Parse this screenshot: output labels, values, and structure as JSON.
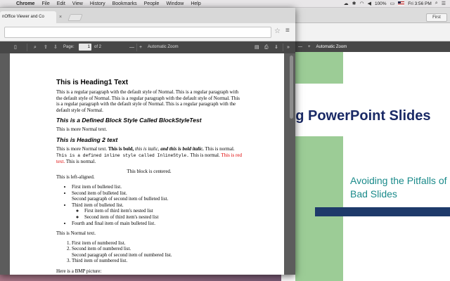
{
  "menubar": {
    "apple": "",
    "items": [
      "Chrome",
      "File",
      "Edit",
      "View",
      "History",
      "Bookmarks",
      "People",
      "Window",
      "Help"
    ],
    "battery": "100%",
    "clock": "Fri 3:56 PM"
  },
  "bg_window": {
    "first_button": "First",
    "zoom": "Automatic Zoom",
    "slide_title": "ng PowerPoint Slides",
    "slide_subtitle": "Avoiding the Pitfalls of Bad Slides"
  },
  "browser": {
    "tab_title": "nOffice Viewer and Co",
    "tab_close": "×",
    "menu_icon": "≡"
  },
  "pdf_toolbar": {
    "page_label": "Page:",
    "page_value": "1",
    "page_total": "of 2",
    "zoom_label": "Automatic Zoom"
  },
  "document": {
    "h1": "This is Heading1 Text",
    "para1": "This is a regular paragraph with the default style of Normal. This is a regular paragraph with the default style of Normal. This is a regular paragraph with the default style of Normal. This is a regular paragraph with the default style of Normal. This is a regular paragraph with the default style of Normal.",
    "block_style": "This is a Defined Block Style Called BlockStyleTest",
    "more_normal": "This is more Normal text.",
    "h2": "This is Heading 2 text",
    "mixed": {
      "t1": "This is more Normal text. ",
      "bold": "This is bold,",
      "t2": " ",
      "italic": "this is italic,",
      "t3": " ",
      "bold_italic": "and this is bold italic.",
      "t4": " This is normal. ",
      "mono": "This is a defined inline style called InlineStyle.",
      "t5": " This is normal. ",
      "red": "This is red text.",
      "t6": " This is normal."
    },
    "centered": "This block is centered.",
    "left_aligned": "This is left-aligned.",
    "bullets": {
      "b1": "First item of bulleted list.",
      "b2": "Second item of bulleted list.",
      "b2_cont": "Second paragraph of second item of bulleted list.",
      "b3": "Third item of bulleted list.",
      "b3_n1": "First item of third item's nested list",
      "b3_n2": "Second item of third item's nested list",
      "b4": "Fourth and final item of main bulleted list."
    },
    "normal_text": "This is Normal text.",
    "numbered": {
      "n1": "First item of numbered list.",
      "n2": "Second item of numbered list.",
      "n2_cont": "Second paragraph of second item of numbered list.",
      "n3": "Third item of numbered list."
    },
    "bmp_label": "Here is a BMP picture:"
  },
  "colors": {
    "slide_green": "#9ccc96",
    "slide_title": "#1a2a66",
    "slide_teal": "#1a8a8a",
    "slide_navy": "#1e3a6a",
    "red_text": "#dd0000"
  }
}
